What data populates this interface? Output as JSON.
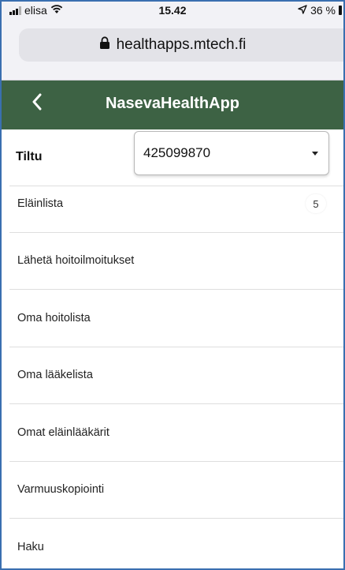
{
  "status_bar": {
    "carrier": "elisa",
    "time": "15.42",
    "battery": "36 %"
  },
  "browser": {
    "url": "healthapps.mtech.fi"
  },
  "header": {
    "title": "NasevaHealthApp"
  },
  "tiltu": {
    "label": "Tiltu",
    "selected": "425099870"
  },
  "menu": {
    "items": [
      {
        "label": "Eläinlista",
        "badge": "5"
      },
      {
        "label": "Lähetä hoitoilmoitukset"
      },
      {
        "label": "Oma hoitolista"
      },
      {
        "label": "Oma lääkelista"
      },
      {
        "label": "Omat eläinlääkärit"
      },
      {
        "label": "Varmuuskopiointi"
      },
      {
        "label": "Haku"
      }
    ]
  }
}
